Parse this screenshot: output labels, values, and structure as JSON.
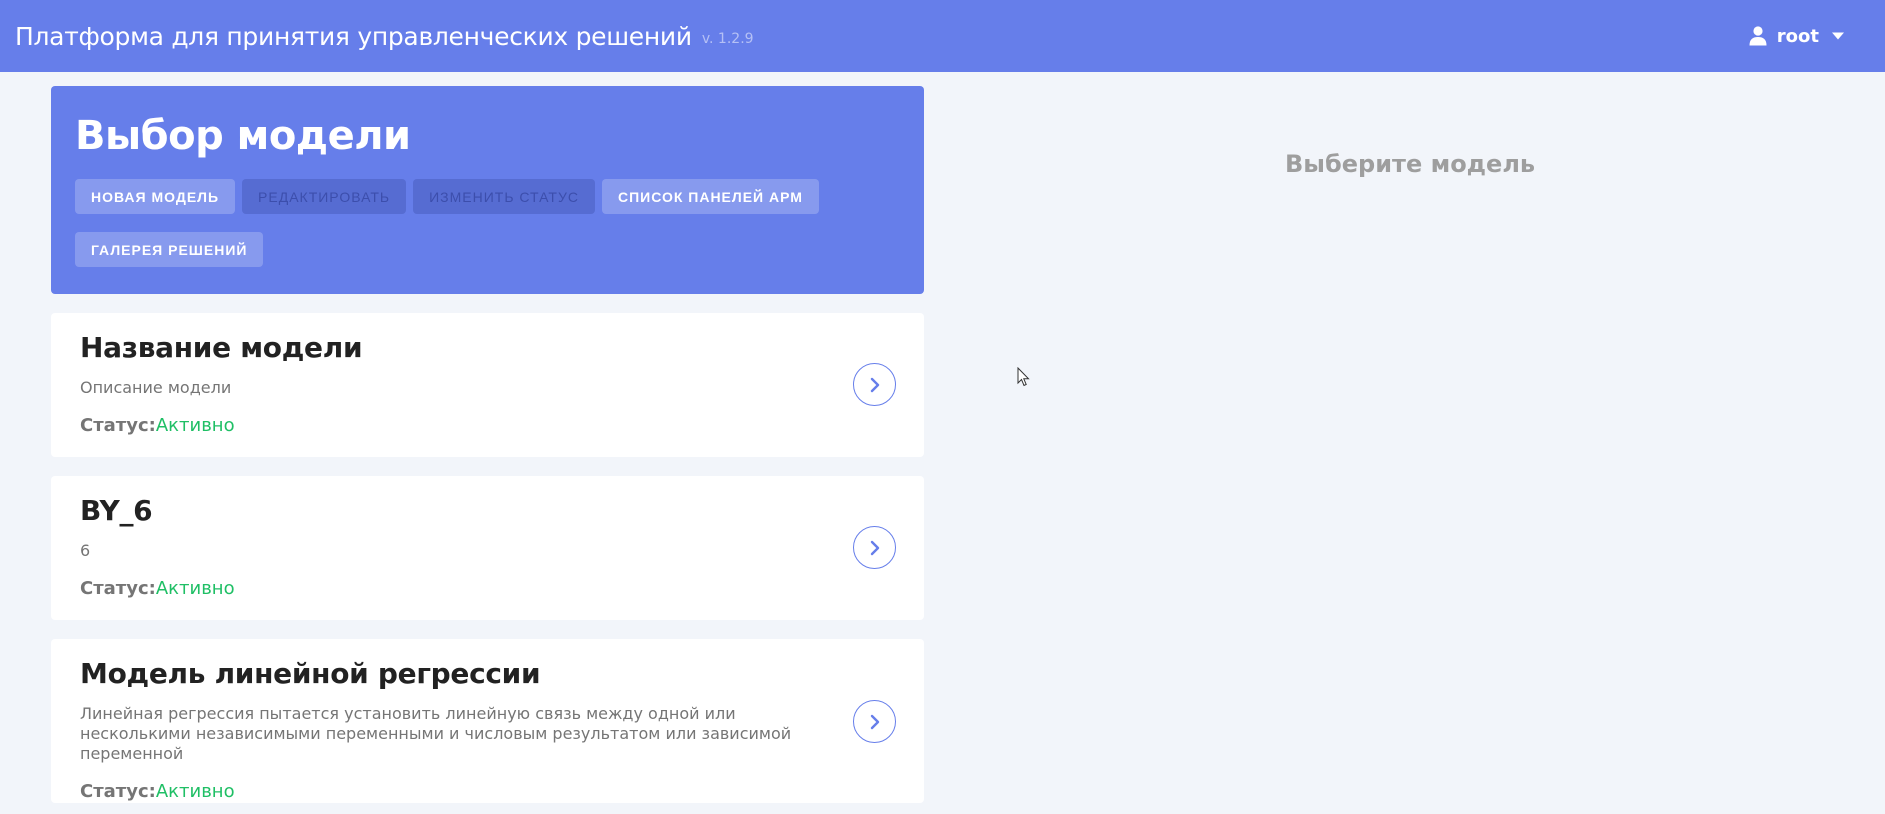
{
  "app": {
    "title": "Платформа для принятия управленческих решений",
    "version": "v. 1.2.9",
    "user": "root",
    "colors": {
      "primary": "#667eea",
      "active": "#1fbf65",
      "background": "#f2f5fa"
    }
  },
  "header": {
    "title": "Выбор модели",
    "buttons": [
      {
        "label": "НОВАЯ МОДЕЛЬ",
        "enabled": true
      },
      {
        "label": "РЕДАКТИРОВАТЬ",
        "enabled": false
      },
      {
        "label": "ИЗМЕНИТЬ СТАТУС",
        "enabled": false
      },
      {
        "label": "СПИСОК ПАНЕЛЕЙ АРМ",
        "enabled": true
      },
      {
        "label": "ГАЛЕРЕЯ РЕШЕНИЙ",
        "enabled": true
      }
    ]
  },
  "models": [
    {
      "title": "Название модели",
      "description": "Описание модели",
      "status_label": "Статус:",
      "status": "Активно"
    },
    {
      "title": "BY_6",
      "description": "6",
      "status_label": "Статус:",
      "status": "Активно"
    },
    {
      "title": "Модель линейной регрессии",
      "description": "Линейная регрессия пытается установить линейную связь между одной или несколькими независимыми переменными и числовым результатом или зависимой переменной",
      "status_label": "Статус:",
      "status": "Активно"
    }
  ],
  "detail": {
    "placeholder": "Выберите модель"
  },
  "icons": {
    "user": "user-icon",
    "caret": "caret-down-icon",
    "arrow": "chevron-right-icon",
    "cursor": "mouse-cursor-icon"
  }
}
